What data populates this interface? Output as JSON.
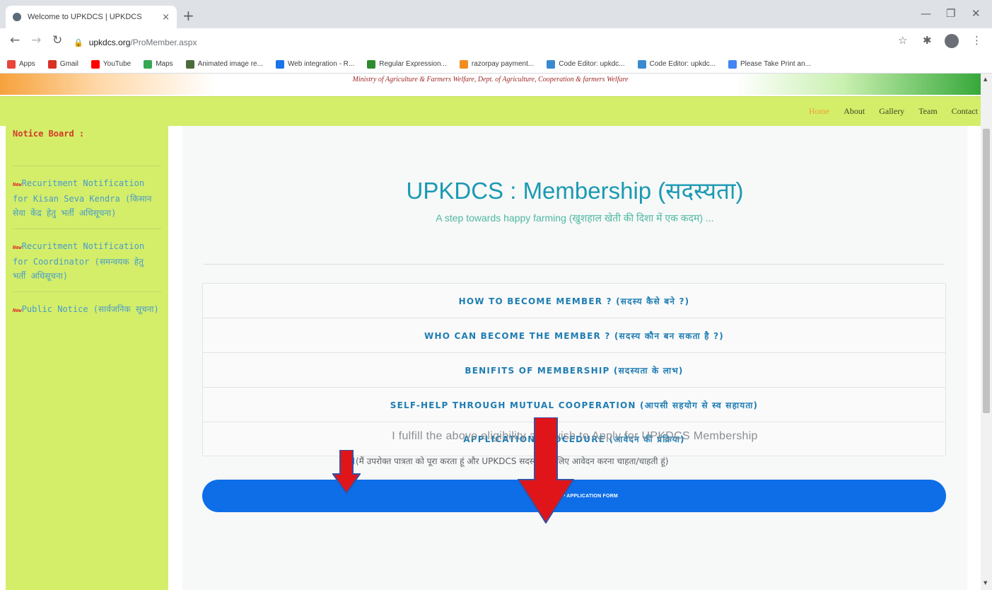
{
  "browser": {
    "tab_title": "Welcome to UPKDCS | UPKDCS",
    "tab_close": "×",
    "new_tab": "+",
    "url_host": "upkdcs.org",
    "url_path": "/ProMember.aspx",
    "bookmarks": [
      {
        "label": "Apps",
        "color": "#e8453c"
      },
      {
        "label": "Gmail",
        "color": "#d93025"
      },
      {
        "label": "YouTube",
        "color": "#ff0000"
      },
      {
        "label": "Maps",
        "color": "#34a853"
      },
      {
        "label": "Animated image re...",
        "color": "#4d6a3a"
      },
      {
        "label": "Web integration - R...",
        "color": "#1a73e8"
      },
      {
        "label": "Regular Expression...",
        "color": "#2e8b2e"
      },
      {
        "label": "razorpay payment...",
        "color": "#f28b20"
      },
      {
        "label": "Code Editor: upkdc...",
        "color": "#3a8ad0"
      },
      {
        "label": "Code Editor: upkdc...",
        "color": "#3a8ad0"
      },
      {
        "label": "Please Take Print an...",
        "color": "#4285f4"
      }
    ]
  },
  "header": {
    "ministry": "Ministry of Agriculture & Farmers Welfare, Dept. of Agriculture, Cooperation & farmers Welfare"
  },
  "nav": {
    "items": [
      "Home",
      "About",
      "Gallery",
      "Team",
      "Contact"
    ]
  },
  "sidebar": {
    "title": "Notice Board :",
    "new_tag": "New",
    "notices": [
      "Recuritment Notification for Kisan Seva Kendra (किसान सेवा केंद्र हेतु भर्ती अधिसूचना)",
      "Recuritment Notification for Coordinator (समन्वयक हेतु भर्ती अधिसूचना)",
      "Public Notice (सार्वजनिक सूचना)"
    ]
  },
  "main": {
    "heading": "UPKDCS : Membership (सदस्यता)",
    "subheading": "A step towards happy farming (खुशहाल खेती की दिशा में एक कदम) ...",
    "accordion": [
      "HOW TO BECOME MEMBER ? (सदस्य कैसे बने ?)",
      "WHO CAN BECOME THE MEMBER ? (सदस्य कौन बन सकता है ?)",
      "BENIFITS OF MEMBERSHIP (सदस्यता के लाभ)",
      "SELF-HELP THROUGH MUTUAL COOPERATION (आपसी सहयोग से स्व सहायता)",
      "APPLICATION PROCEDURE (आवेदन की प्रक्रिया)"
    ],
    "eligibility": "I fulfill the above eligibility and wish to Apply for UPKDCS Membership",
    "consent_hindi": "(मैं उपरोक्त पात्रता को पूरा करता हूं और UPKDCS सदस्यता के लिए आवेदन करना चाहता/चाहती हूं)",
    "consent_checked": true,
    "apply_button": "MEMBERSHIP APPLICATION FORM"
  },
  "colors": {
    "nav_green": "#d4ee6a",
    "heading_teal": "#1a9ab2",
    "button_blue": "#0d6ee8",
    "annotation_red": "#e0151a"
  }
}
